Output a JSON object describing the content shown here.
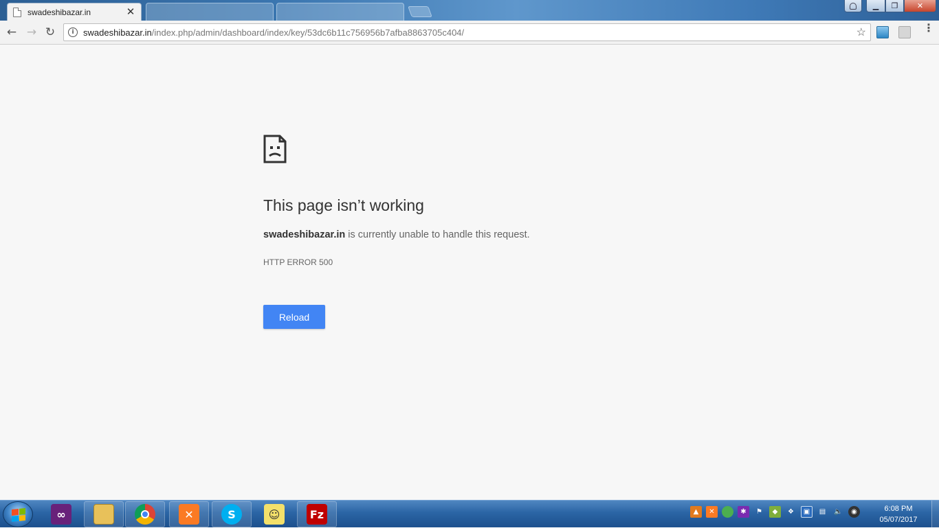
{
  "browser": {
    "active_tab": {
      "title": "swadeshibazar.in",
      "close": "✕"
    },
    "background_tabs": [
      {
        "title": ""
      },
      {
        "title": ""
      }
    ],
    "omnibox": {
      "url_host": "swadeshibazar.in",
      "url_path": "/index.php/admin/dashboard/index/key/53dc6b11c756956b7afba8863705c404/"
    }
  },
  "error_page": {
    "title": "This page isn’t working",
    "host": "swadeshibazar.in",
    "message": " is currently unable to handle this request.",
    "code": "HTTP ERROR 500",
    "reload_label": "Reload",
    "reload_color": "#4285f4"
  },
  "taskbar": {
    "apps": [
      {
        "name": "visual-studio-icon",
        "color": "#68217a"
      },
      {
        "name": "file-explorer-icon",
        "color": "#e8c15a"
      },
      {
        "name": "chrome-icon",
        "color": "#db4437"
      },
      {
        "name": "xampp-icon",
        "color": "#fb7a24"
      },
      {
        "name": "skype-icon",
        "color": "#00aff0"
      },
      {
        "name": "sticky-app-icon",
        "color": "#f3e06a"
      },
      {
        "name": "filezilla-icon",
        "color": "#bf0000"
      }
    ],
    "clock": {
      "time": "6:08 PM",
      "date": "05/07/2017"
    }
  }
}
